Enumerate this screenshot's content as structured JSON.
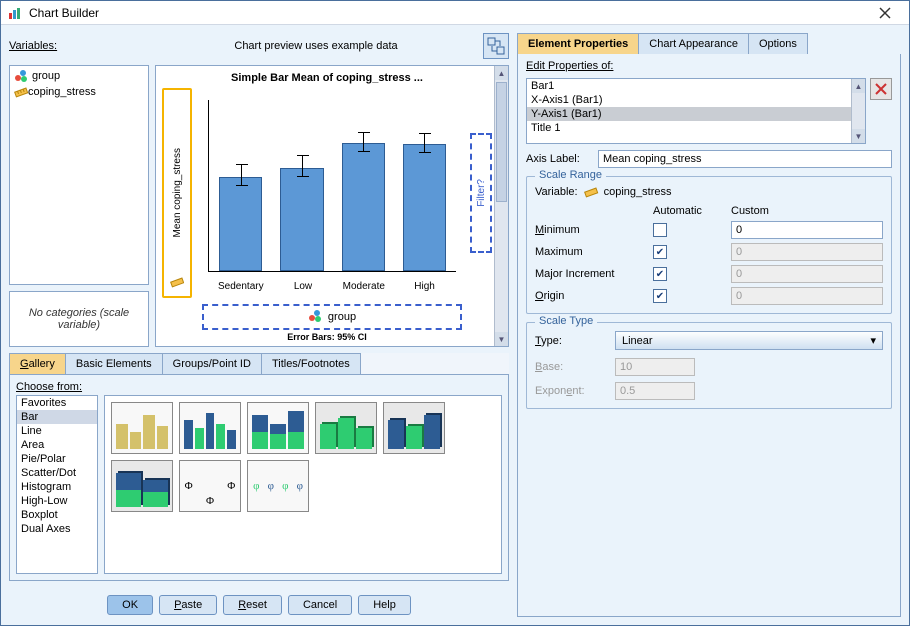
{
  "window": {
    "title": "Chart Builder"
  },
  "left": {
    "variables_label": "Variables:",
    "preview_label": "Chart preview uses example data",
    "variables": [
      {
        "icon": "legend",
        "label": "group"
      },
      {
        "icon": "ruler",
        "label": "coping_stress"
      }
    ],
    "no_categories": "No categories (scale variable)",
    "preview": {
      "title": "Simple Bar Mean of coping_stress ...",
      "y_label": "Mean coping_stress",
      "filter_label": "Filter?",
      "group_label": "group",
      "errbars_label": "Error Bars: 95% CI",
      "categories": [
        "Sedentary",
        "Low",
        "Moderate",
        "High"
      ]
    },
    "tabs": [
      "Gallery",
      "Basic Elements",
      "Groups/Point ID",
      "Titles/Footnotes"
    ],
    "choose_from": "Choose from:",
    "chart_types": [
      "Favorites",
      "Bar",
      "Line",
      "Area",
      "Pie/Polar",
      "Scatter/Dot",
      "Histogram",
      "High-Low",
      "Boxplot",
      "Dual Axes"
    ],
    "buttons": {
      "ok": "OK",
      "paste": "Paste",
      "reset": "Reset",
      "cancel": "Cancel",
      "help": "Help"
    }
  },
  "right": {
    "tabs": [
      "Element Properties",
      "Chart Appearance",
      "Options"
    ],
    "edit_props_label": "Edit Properties of:",
    "edit_items": [
      "Bar1",
      "X-Axis1 (Bar1)",
      "Y-Axis1 (Bar1)",
      "Title 1"
    ],
    "axis_label_label": "Axis Label:",
    "axis_label_value": "Mean coping_stress",
    "scale_range": {
      "legend": "Scale Range",
      "variable_label": "Variable:",
      "variable_value": "coping_stress",
      "auto_hdr": "Automatic",
      "custom_hdr": "Custom",
      "rows": {
        "min": {
          "label": "Minimum",
          "auto": false,
          "value": "0"
        },
        "max": {
          "label": "Maximum",
          "auto": true,
          "value": "0"
        },
        "major": {
          "label": "Major Increment",
          "auto": true,
          "value": "0"
        },
        "origin": {
          "label": "Origin",
          "auto": true,
          "value": "0"
        }
      }
    },
    "scale_type": {
      "legend": "Scale Type",
      "type_label": "Type:",
      "type_value": "Linear",
      "base_label": "Base:",
      "base_value": "10",
      "exp_label": "Exponent:",
      "exp_value": "0.5"
    }
  },
  "chart_data": {
    "type": "bar",
    "title": "Simple Bar Mean of coping_stress ...",
    "ylabel": "Mean coping_stress",
    "categories": [
      "Sedentary",
      "Low",
      "Moderate",
      "High"
    ],
    "values": [
      55,
      60,
      75,
      74
    ],
    "error_bars": {
      "ci": 95
    }
  }
}
